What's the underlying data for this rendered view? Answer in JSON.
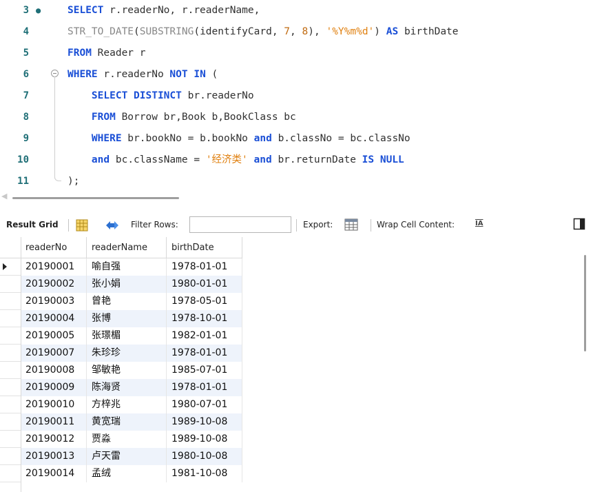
{
  "editor": {
    "lines": [
      {
        "num": "3",
        "marker": "●",
        "fold": false,
        "tokens": [
          [
            "kw",
            "SELECT "
          ],
          [
            "t",
            "r.readerNo, r.readerName,"
          ]
        ]
      },
      {
        "num": "4",
        "marker": "",
        "fold": false,
        "tokens": [
          [
            "fn",
            "STR_TO_DATE"
          ],
          [
            "t",
            "("
          ],
          [
            "fn",
            "SUBSTRING"
          ],
          [
            "t",
            "(identifyCard, "
          ],
          [
            "num",
            "7"
          ],
          [
            "t",
            ", "
          ],
          [
            "num",
            "8"
          ],
          [
            "t",
            "), "
          ],
          [
            "str",
            "'%Y%m%d'"
          ],
          [
            "t",
            ") "
          ],
          [
            "kw",
            "AS"
          ],
          [
            "t",
            " birthDate"
          ]
        ]
      },
      {
        "num": "5",
        "marker": "",
        "fold": false,
        "tokens": [
          [
            "kw",
            "FROM"
          ],
          [
            "t",
            " Reader r"
          ]
        ]
      },
      {
        "num": "6",
        "marker": "",
        "fold": true,
        "tokens": [
          [
            "kw",
            "WHERE"
          ],
          [
            "t",
            " r.readerNo "
          ],
          [
            "kw",
            "NOT IN"
          ],
          [
            "t",
            " ("
          ]
        ]
      },
      {
        "num": "7",
        "marker": "",
        "fold": false,
        "tokens": [
          [
            "t",
            "    "
          ],
          [
            "kw",
            "SELECT DISTINCT"
          ],
          [
            "t",
            " br.readerNo"
          ]
        ]
      },
      {
        "num": "8",
        "marker": "",
        "fold": false,
        "tokens": [
          [
            "t",
            "    "
          ],
          [
            "kw",
            "FROM"
          ],
          [
            "t",
            " Borrow br,Book b,BookClass bc"
          ]
        ]
      },
      {
        "num": "9",
        "marker": "",
        "fold": false,
        "tokens": [
          [
            "t",
            "    "
          ],
          [
            "kw",
            "WHERE"
          ],
          [
            "t",
            " br.bookNo = b.bookNo "
          ],
          [
            "kw",
            "and"
          ],
          [
            "t",
            " b.classNo = bc.classNo"
          ]
        ]
      },
      {
        "num": "10",
        "marker": "",
        "fold": false,
        "tokens": [
          [
            "t",
            "    "
          ],
          [
            "kw",
            "and"
          ],
          [
            "t",
            " bc.className = "
          ],
          [
            "str",
            "'经济类'"
          ],
          [
            "t",
            " "
          ],
          [
            "kw",
            "and"
          ],
          [
            "t",
            " br.returnDate "
          ],
          [
            "kw",
            "IS NULL"
          ]
        ]
      },
      {
        "num": "11",
        "marker": "",
        "fold": false,
        "tokens": [
          [
            "t",
            ");"
          ]
        ]
      }
    ]
  },
  "toolbar": {
    "result_grid_label": "Result Grid",
    "filter_label": "Filter Rows:",
    "filter_value": "",
    "export_label": "Export:",
    "wrap_label": "Wrap Cell Content:",
    "wrap_icon": "IA"
  },
  "grid": {
    "columns": [
      "readerNo",
      "readerName",
      "birthDate"
    ],
    "rows": [
      [
        "20190001",
        "喻自强",
        "1978-01-01"
      ],
      [
        "20190002",
        "张小娟",
        "1980-01-01"
      ],
      [
        "20190003",
        "曾艳",
        "1978-05-01"
      ],
      [
        "20190004",
        "张博",
        "1978-10-01"
      ],
      [
        "20190005",
        "张璟楣",
        "1982-01-01"
      ],
      [
        "20190007",
        "朱珍珍",
        "1978-01-01"
      ],
      [
        "20190008",
        "邹敏艳",
        "1985-07-01"
      ],
      [
        "20190009",
        "陈海贤",
        "1978-01-01"
      ],
      [
        "20190010",
        "方梓兆",
        "1980-07-01"
      ],
      [
        "20190011",
        "黄宽瑞",
        "1989-10-08"
      ],
      [
        "20190012",
        "贾淼",
        "1989-10-08"
      ],
      [
        "20190013",
        "卢天雷",
        "1980-10-08"
      ],
      [
        "20190014",
        "孟绒",
        "1981-10-08"
      ]
    ],
    "selected_row": 0
  },
  "colors": {
    "keyword": "#1a4fd6",
    "string": "#e08010",
    "number": "#c06a10",
    "line_number": "#1f6f77",
    "alt_row": "#eef3fb"
  }
}
